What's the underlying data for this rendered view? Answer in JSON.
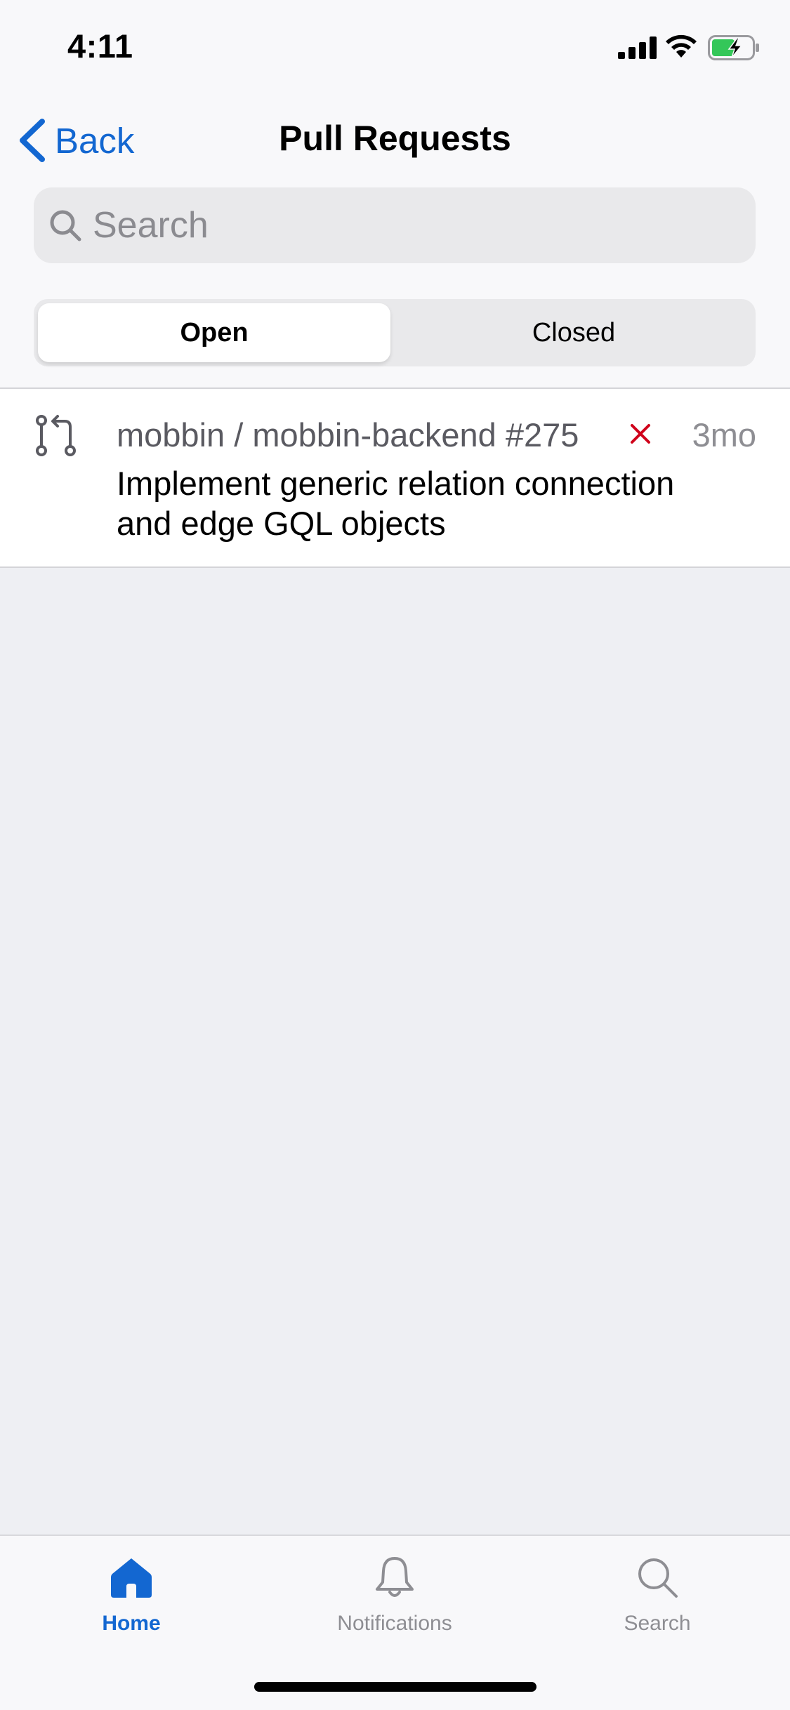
{
  "status_bar": {
    "time": "4:11",
    "battery": "charging"
  },
  "nav": {
    "back_label": "Back",
    "title": "Pull Requests"
  },
  "search": {
    "placeholder": "Search",
    "value": ""
  },
  "segments": {
    "items": [
      "Open",
      "Closed"
    ],
    "selected": "Open"
  },
  "pull_requests": [
    {
      "repo": "mobbin / mobbin-backend #275",
      "status_icon": "close-icon",
      "status_color": "#d0021b",
      "age": "3mo",
      "title": "Implement generic relation connection and edge GQL objects"
    }
  ],
  "tab_bar": {
    "items": [
      {
        "label": "Home",
        "icon": "home-icon",
        "selected": true
      },
      {
        "label": "Notifications",
        "icon": "bell-icon",
        "selected": false
      },
      {
        "label": "Search",
        "icon": "search-icon",
        "selected": false
      }
    ]
  },
  "colors": {
    "accent": "#1367d1",
    "background": "#eeeff3",
    "error": "#d0021b"
  }
}
